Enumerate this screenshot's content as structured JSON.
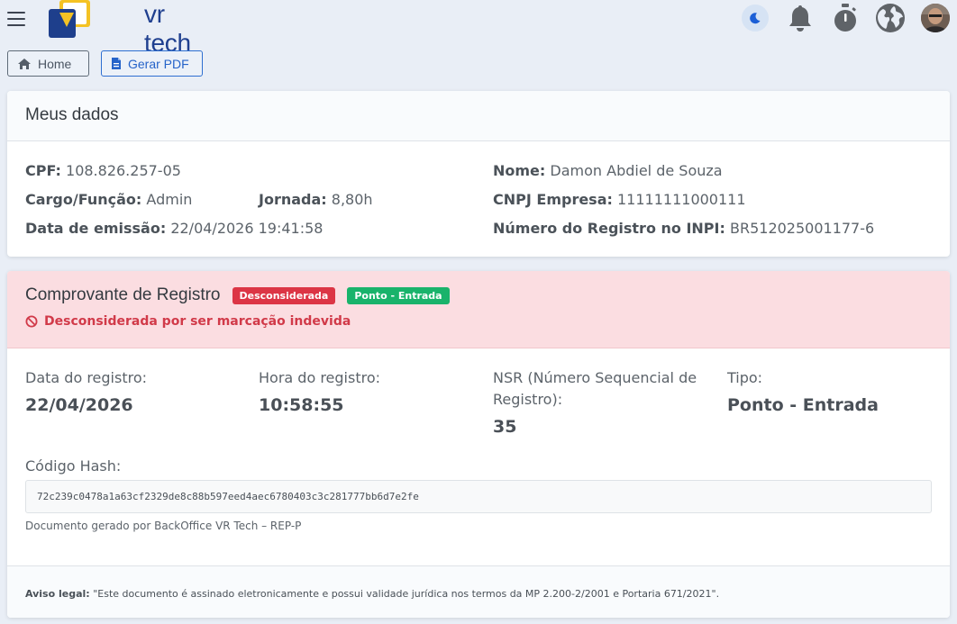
{
  "header": {
    "logo_text": "vr tech",
    "icons": [
      "menu-icon",
      "moon-icon",
      "bell-icon",
      "stopwatch-icon",
      "globe-icon",
      "avatar"
    ],
    "colors": {
      "brand": "#1f3f8f",
      "logo_yellow": "#f4c224",
      "logo_blue": "#1e3f8c"
    }
  },
  "toolbar": {
    "home_label": "Home",
    "pdf_label": "Gerar PDF"
  },
  "meus_dados": {
    "title": "Meus dados",
    "cpf_label": "CPF:",
    "cpf_value": "108.826.257-05",
    "nome_label": "Nome:",
    "nome_value": "Damon Abdiel de Souza",
    "cargo_label": "Cargo/Função:",
    "cargo_value": "Admin",
    "jornada_label": "Jornada:",
    "jornada_value": "8,80h",
    "cnpj_label": "CNPJ Empresa:",
    "cnpj_value": "11111111000111",
    "emissao_label": "Data de emissão:",
    "emissao_value": "22/04/2026 19:41:58",
    "inpi_label": "Número do Registro no INPI:",
    "inpi_value": "BR512025001177-6"
  },
  "comprovante": {
    "title": "Comprovante de Registro",
    "badge_status": "Desconsiderada",
    "badge_tipo": "Ponto - Entrada",
    "warning": "Desconsiderada por ser marcação indevida",
    "colors": {
      "header_bg": "#fbdde1",
      "danger": "#dc3545",
      "success": "#19b36b"
    },
    "data_label": "Data do registro:",
    "data_value": "22/04/2026",
    "hora_label": "Hora do registro:",
    "hora_value": "10:58:55",
    "nsr_label_1": "NSR (Número Sequencial de",
    "nsr_label_2": "Registro):",
    "nsr_value": "35",
    "tipo_label": "Tipo:",
    "tipo_value": "Ponto - Entrada",
    "hash_label": "Código Hash:",
    "hash_value": "72c239c0478a1a63cf2329de8c88b597eed4aec6780403c3c281777bb6d7e2fe",
    "generated_by": "Documento gerado por BackOffice VR Tech – REP-P",
    "aviso_label": "Aviso legal:",
    "aviso_text": "\"Este documento é assinado eletronicamente e possui validade jurídica nos termos da MP 2.200-2/2001 e Portaria 671/2021\"."
  }
}
